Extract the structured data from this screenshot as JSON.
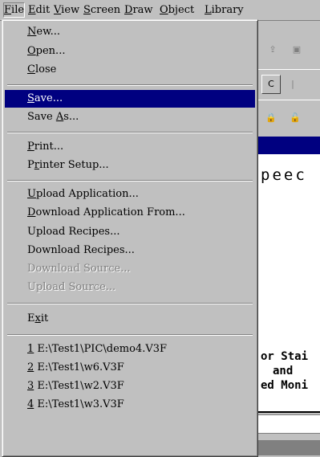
{
  "menubar": {
    "items": [
      {
        "label": "File",
        "accel": "F",
        "rest": "ile"
      },
      {
        "label": "Edit",
        "accel": "E",
        "rest": "dit"
      },
      {
        "label": "View",
        "accel": "V",
        "rest": "iew"
      },
      {
        "label": "Screen",
        "accel": "S",
        "rest": "creen"
      },
      {
        "label": "Draw",
        "accel": "D",
        "rest": "raw"
      },
      {
        "label": "Object",
        "accel": "O",
        "rest": "bject"
      },
      {
        "label": "Library",
        "accel": "L",
        "rest": "ibrary"
      }
    ]
  },
  "file_menu": {
    "items": [
      {
        "pre": "",
        "accel": "N",
        "post": "ew..."
      },
      {
        "pre": "",
        "accel": "O",
        "post": "pen..."
      },
      {
        "pre": "",
        "accel": "C",
        "post": "lose"
      },
      {
        "pre": "",
        "accel": "S",
        "post": "ave...",
        "selected": true
      },
      {
        "pre": "Save ",
        "accel": "A",
        "post": "s..."
      },
      {
        "pre": "",
        "accel": "P",
        "post": "rint..."
      },
      {
        "pre": "P",
        "accel": "r",
        "post": "inter Setup..."
      },
      {
        "pre": "",
        "accel": "U",
        "post": "pload Application..."
      },
      {
        "pre": "",
        "accel": "D",
        "post": "ownload Application From..."
      },
      {
        "pre": "Upload Recipes...",
        "accel": "",
        "post": ""
      },
      {
        "pre": "Download Recipes...",
        "accel": "",
        "post": ""
      },
      {
        "pre": "Download Source...",
        "accel": "",
        "post": "",
        "disabled": true
      },
      {
        "pre": "Upload Source...",
        "accel": "",
        "post": "",
        "disabled": true
      },
      {
        "pre": "E",
        "accel": "x",
        "post": "it"
      },
      {
        "pre": "",
        "accel": "1",
        "post": " E:\\Test1\\PIC\\demo4.V3F"
      },
      {
        "pre": "",
        "accel": "2",
        "post": " E:\\Test1\\w6.V3F"
      },
      {
        "pre": "",
        "accel": "3",
        "post": " E:\\Test1\\w2.V3F"
      },
      {
        "pre": "",
        "accel": "4",
        "post": " E:\\Test1\\w3.V3F"
      }
    ]
  },
  "background": {
    "canvas_line1": "peec",
    "canvas_line2": "or Stai",
    "canvas_line3": "and",
    "canvas_line4": "ed Moni"
  },
  "colors": {
    "menu_bg": "#c0c0c0",
    "selection": "#000080",
    "disabled_text": "#808080"
  }
}
